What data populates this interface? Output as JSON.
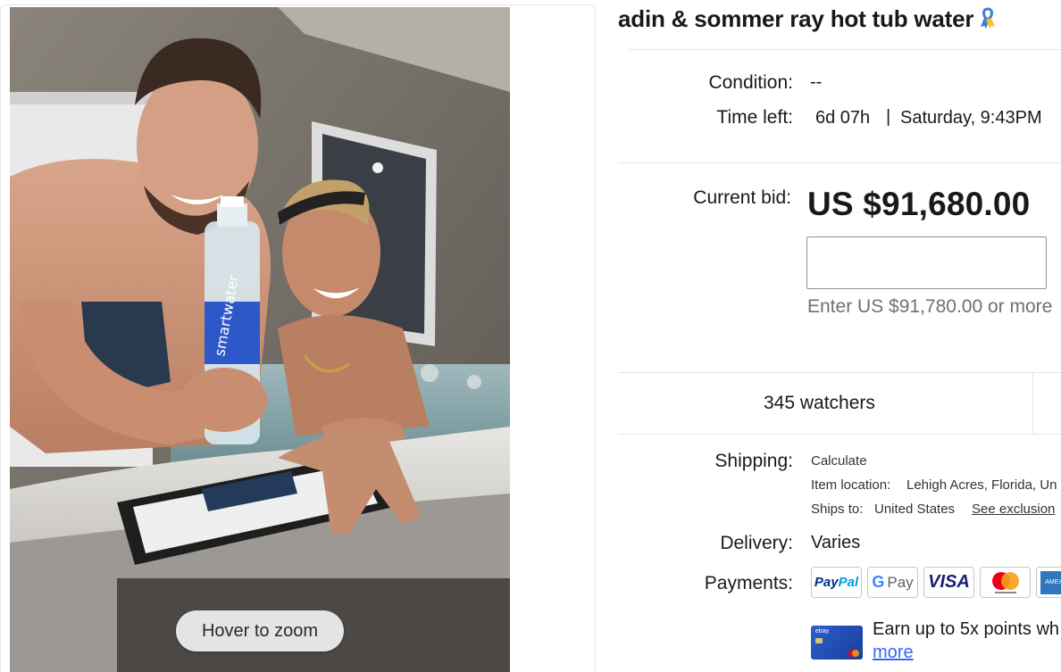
{
  "listing": {
    "title": "adin & sommer ray hot tub water",
    "condition_label": "Condition:",
    "condition_value": "--",
    "time_left_label": "Time left:",
    "time_left_value": "6d 07h",
    "time_left_separator": "|",
    "end_time": "Saturday, 9:43PM",
    "current_bid_label": "Current bid:",
    "current_bid_value": "US $91,680.00",
    "bid_hint": "Enter US $91,780.00 or more",
    "watchers": "345 watchers",
    "shipping_label": "Shipping:",
    "shipping_link": "Calculate",
    "item_location_label": "Item location:",
    "item_location_value": "Lehigh Acres, Florida, Un",
    "ships_to_label": "Ships to:",
    "ships_to_value": "United States",
    "see_exclusions": "See exclusion",
    "delivery_label": "Delivery:",
    "delivery_value": "Varies",
    "payments_label": "Payments:",
    "earn_text": "Earn up to 5x points wh",
    "earn_more": "more"
  },
  "image": {
    "zoom_label": "Hover to zoom",
    "bottle_text": "smartwater"
  },
  "payment_methods": [
    "PayPal",
    "G Pay",
    "VISA",
    "mastercard",
    "AMEX"
  ],
  "colors": {
    "link": "#3665f3",
    "hint": "#707070",
    "divider": "#e5e5e5",
    "paypal_dark": "#003087",
    "paypal_light": "#009cde",
    "visa": "#1a1f71",
    "mc_red": "#eb001b",
    "mc_orange": "#f79e1b",
    "amex": "#2e77bc"
  }
}
